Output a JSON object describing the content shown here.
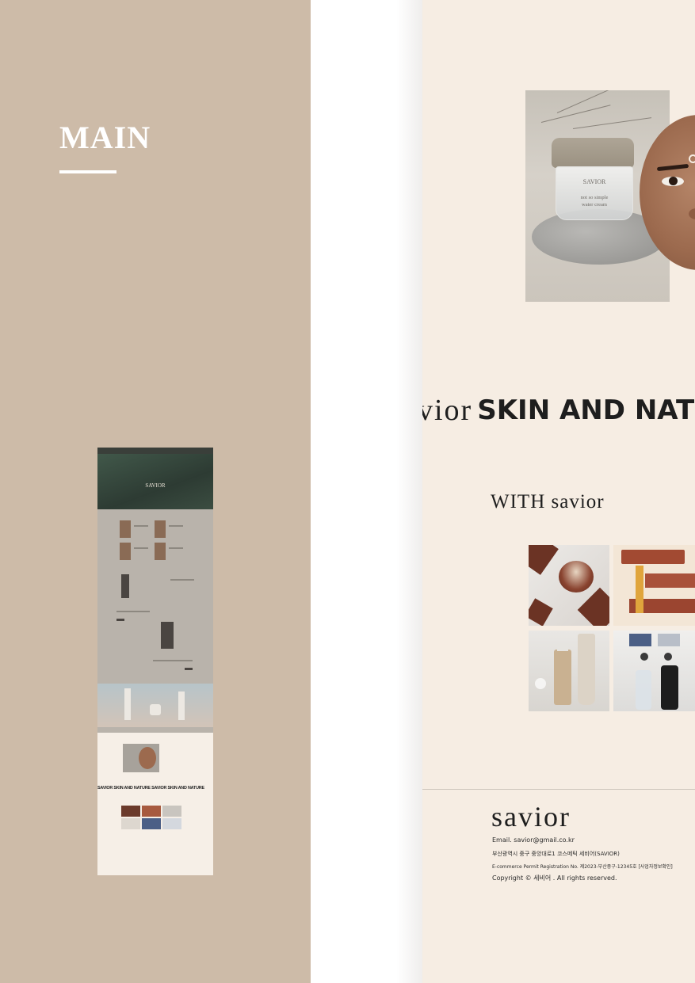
{
  "left": {
    "title": "MAIN"
  },
  "thumbnail": {
    "hero_brand": "SAVIOR",
    "marquee": "SAVIOR SKIN AND NATURE SAVIOR SKIN AND NATURE"
  },
  "preview": {
    "jar": {
      "brand": "SAVIOR",
      "line1": "not so simple",
      "line2": "water cream"
    },
    "marquee": {
      "brand": "vior",
      "tagline": "SKIN AND NATU"
    },
    "section_title": "WITH savior",
    "footer": {
      "logo": "savior",
      "email": "Email. savior@gmail.co.kr",
      "address": "부산광역시 중구 중앙대로1 코스메틱 세비어(SAVIOR)",
      "permit": "E-commerce Permit Registration No. 제2023-부산중구-12345호 [사업자정보확인]",
      "copyright": "Copyright © 세비어 . All rights reserved."
    }
  },
  "colors": {
    "left_panel": "#cdbba8",
    "page_bg": "#f6ede3",
    "text": "#1e1e1e"
  }
}
